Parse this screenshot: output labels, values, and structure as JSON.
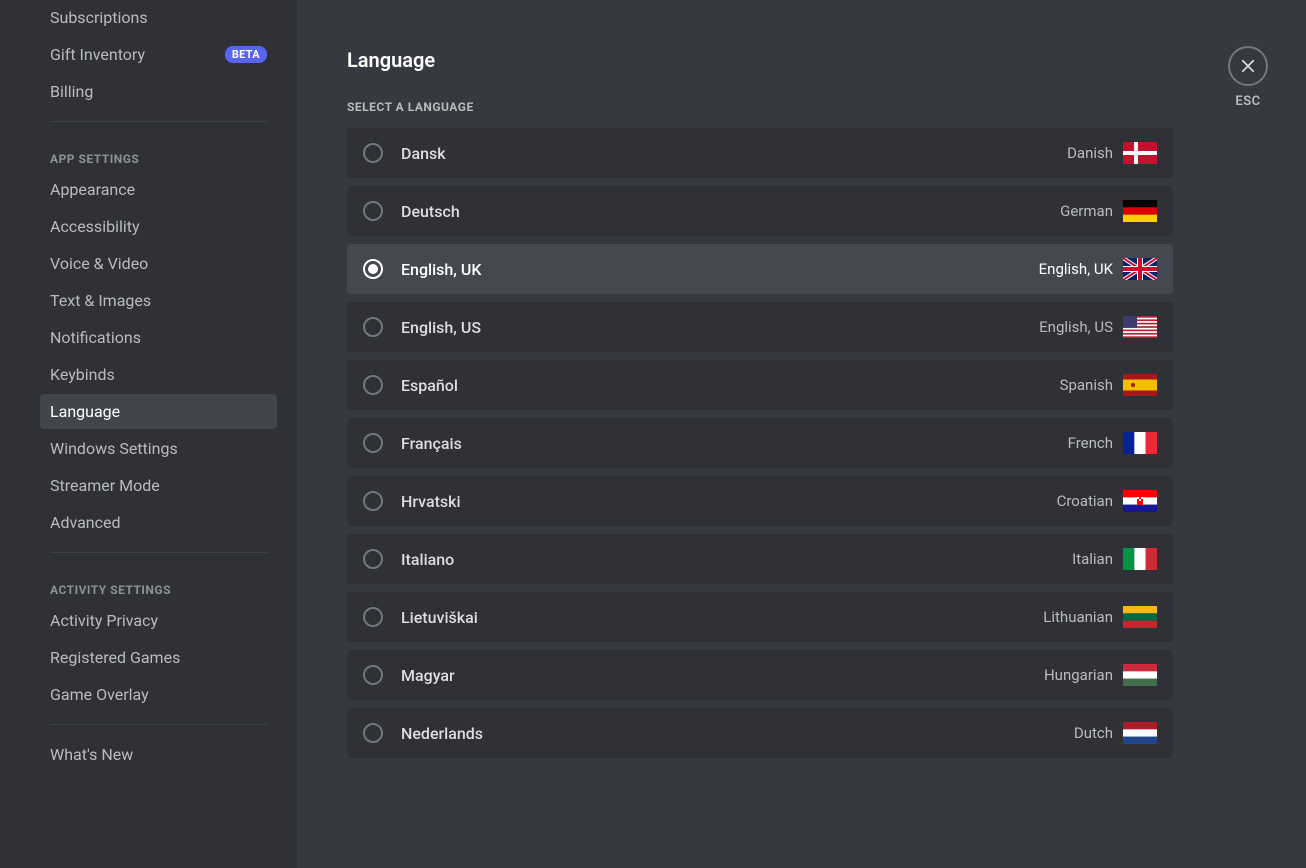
{
  "sidebar": {
    "items_top": [
      {
        "label": "Subscriptions",
        "badge": null
      },
      {
        "label": "Gift Inventory",
        "badge": "BETA"
      },
      {
        "label": "Billing",
        "badge": null
      }
    ],
    "header_app": "APP SETTINGS",
    "items_app": [
      {
        "label": "Appearance",
        "selected": false
      },
      {
        "label": "Accessibility",
        "selected": false
      },
      {
        "label": "Voice & Video",
        "selected": false
      },
      {
        "label": "Text & Images",
        "selected": false
      },
      {
        "label": "Notifications",
        "selected": false
      },
      {
        "label": "Keybinds",
        "selected": false
      },
      {
        "label": "Language",
        "selected": true
      },
      {
        "label": "Windows Settings",
        "selected": false
      },
      {
        "label": "Streamer Mode",
        "selected": false
      },
      {
        "label": "Advanced",
        "selected": false
      }
    ],
    "header_activity": "ACTIVITY SETTINGS",
    "items_activity": [
      {
        "label": "Activity Privacy"
      },
      {
        "label": "Registered Games"
      },
      {
        "label": "Game Overlay"
      }
    ],
    "items_bottom": [
      {
        "label": "What's New"
      }
    ]
  },
  "main": {
    "title": "Language",
    "section_header": "SELECT A LANGUAGE",
    "close_label": "ESC",
    "languages": [
      {
        "native": "Dansk",
        "english": "Danish",
        "flag": "dk",
        "selected": false
      },
      {
        "native": "Deutsch",
        "english": "German",
        "flag": "de",
        "selected": false
      },
      {
        "native": "English, UK",
        "english": "English, UK",
        "flag": "gb",
        "selected": true
      },
      {
        "native": "English, US",
        "english": "English, US",
        "flag": "us",
        "selected": false
      },
      {
        "native": "Español",
        "english": "Spanish",
        "flag": "es",
        "selected": false
      },
      {
        "native": "Français",
        "english": "French",
        "flag": "fr",
        "selected": false
      },
      {
        "native": "Hrvatski",
        "english": "Croatian",
        "flag": "hr",
        "selected": false
      },
      {
        "native": "Italiano",
        "english": "Italian",
        "flag": "it",
        "selected": false
      },
      {
        "native": "Lietuviškai",
        "english": "Lithuanian",
        "flag": "lt",
        "selected": false
      },
      {
        "native": "Magyar",
        "english": "Hungarian",
        "flag": "hu",
        "selected": false
      },
      {
        "native": "Nederlands",
        "english": "Dutch",
        "flag": "nl",
        "selected": false
      }
    ]
  },
  "flags": {
    "dk": "<svg viewBox='0 0 34 22'><rect width='34' height='22' fill='#c8102e'/><rect x='11' width='4' height='22' fill='#fff'/><rect y='9' width='34' height='4' fill='#fff'/></svg>",
    "de": "<svg viewBox='0 0 34 22'><rect width='34' height='7.33' y='0' fill='#000'/><rect width='34' height='7.34' y='7.33' fill='#dd0000'/><rect width='34' height='7.33' y='14.67' fill='#ffce00'/></svg>",
    "gb": "<svg viewBox='0 0 34 22'><rect width='34' height='22' fill='#012169'/><path d='M0 0L34 22M34 0L0 22' stroke='#fff' stroke-width='4'/><path d='M0 0L34 22M34 0L0 22' stroke='#c8102e' stroke-width='2'/><rect x='14' width='6' height='22' fill='#fff'/><rect y='8' width='34' height='6' fill='#fff'/><rect x='15' width='4' height='22' fill='#c8102e'/><rect y='9' width='34' height='4' fill='#c8102e'/></svg>",
    "us": "<svg viewBox='0 0 34 22'><rect width='34' height='22' fill='#b22234'/><rect y='1.69' width='34' height='1.69' fill='#fff'/><rect y='5.08' width='34' height='1.69' fill='#fff'/><rect y='8.46' width='34' height='1.69' fill='#fff'/><rect y='11.85' width='34' height='1.69' fill='#fff'/><rect y='15.23' width='34' height='1.69' fill='#fff'/><rect y='18.62' width='34' height='1.69' fill='#fff'/><rect width='14' height='11.85' fill='#3c3b6e'/></svg>",
    "es": "<svg viewBox='0 0 34 22'><rect width='34' height='22' fill='#aa151b'/><rect y='5.5' width='34' height='11' fill='#f1bf00'/><circle cx='10' cy='11' r='2' fill='#aa151b'/></svg>",
    "fr": "<svg viewBox='0 0 34 22'><rect width='11.33' height='22' fill='#002395'/><rect x='11.33' width='11.34' height='22' fill='#fff'/><rect x='22.67' width='11.33' height='22' fill='#ed2939'/></svg>",
    "hr": "<svg viewBox='0 0 34 22'><rect width='34' height='7.33' fill='#ff0000'/><rect y='7.33' width='34' height='7.34' fill='#fff'/><rect y='14.67' width='34' height='7.33' fill='#171796'/><rect x='14' y='7' width='6' height='8' fill='#ff0000'/><rect x='14' y='7' width='2' height='2' fill='#fff'/><rect x='18' y='7' width='2' height='2' fill='#fff'/><rect x='16' y='9' width='2' height='2' fill='#fff'/></svg>",
    "it": "<svg viewBox='0 0 34 22'><rect width='11.33' height='22' fill='#009246'/><rect x='11.33' width='11.34' height='22' fill='#fff'/><rect x='22.67' width='11.33' height='22' fill='#ce2b37'/></svg>",
    "lt": "<svg viewBox='0 0 34 22'><rect width='34' height='7.33' fill='#fdb913'/><rect y='7.33' width='34' height='7.34' fill='#006a44'/><rect y='14.67' width='34' height='7.33' fill='#c1272d'/></svg>",
    "hu": "<svg viewBox='0 0 34 22'><rect width='34' height='7.33' fill='#cd2a3e'/><rect y='7.33' width='34' height='7.34' fill='#fff'/><rect y='14.67' width='34' height='7.33' fill='#436f4d'/></svg>",
    "nl": "<svg viewBox='0 0 34 22'><rect width='34' height='7.33' fill='#ae1c28'/><rect y='7.33' width='34' height='7.34' fill='#fff'/><rect y='14.67' width='34' height='7.33' fill='#21468b'/></svg>"
  }
}
